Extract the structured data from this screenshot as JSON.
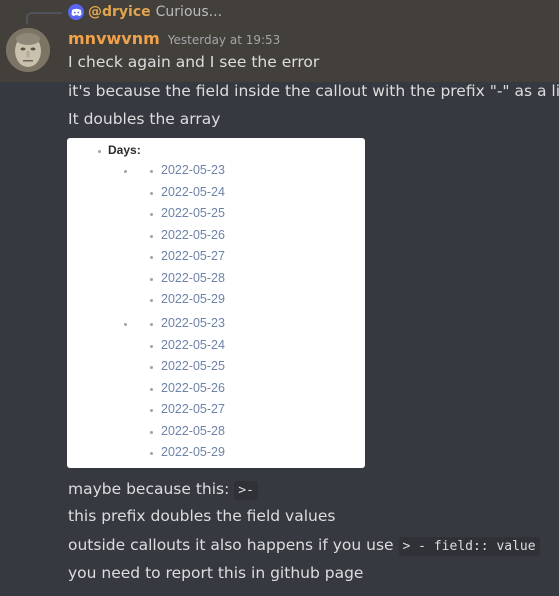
{
  "reply": {
    "username": "@dryice",
    "preview": "Curious..."
  },
  "message": {
    "author": "mnvwvnm",
    "timestamp": "Yesterday at 19:53",
    "lines_before": [
      "I check again and I see the error",
      "it's because the field inside the callout with the prefix \"-\" as a list",
      "It doubles the array"
    ],
    "line_maybe_prefix": "maybe because this:",
    "line_maybe_code": ">-",
    "line_doubles": "this prefix doubles the field values",
    "line_outside_prefix": "outside callouts it also happens if you use",
    "line_outside_code": "> - field:: value",
    "line_report": "you need to report this in github page"
  },
  "embed": {
    "field_label": "Days:",
    "group1": [
      "2022-05-23",
      "2022-05-24",
      "2022-05-25",
      "2022-05-26",
      "2022-05-27",
      "2022-05-28",
      "2022-05-29"
    ],
    "group2": [
      "2022-05-23",
      "2022-05-24",
      "2022-05-25",
      "2022-05-26",
      "2022-05-27",
      "2022-05-28",
      "2022-05-29"
    ]
  },
  "colors": {
    "background": "#36393f",
    "highlight": "#433f3a",
    "author": "#f0a14a",
    "reply_name": "#e0a550",
    "text": "#dcddde",
    "date_link": "#6e83a8"
  }
}
